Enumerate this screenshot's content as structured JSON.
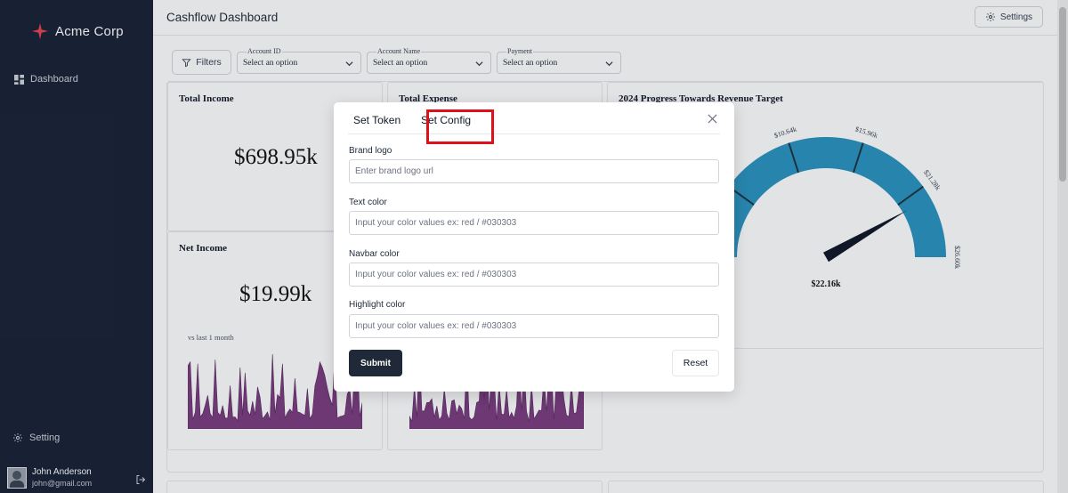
{
  "sidebar": {
    "brand_name": "Acme Corp",
    "brand_color": "#e8454f",
    "nav_items": [
      {
        "label": "Dashboard",
        "icon": "dashboard-icon"
      },
      {
        "label": "Setting",
        "icon": "gear-icon"
      }
    ],
    "user": {
      "name": "John Anderson",
      "email": "john@gmail.com"
    }
  },
  "header": {
    "title": "Cashflow Dashboard",
    "settings_label": "Settings"
  },
  "filters": {
    "button_label": "Filters",
    "selects": [
      {
        "label": "Account ID",
        "value": "Select an option"
      },
      {
        "label": "Account Name",
        "value": "Select an option"
      },
      {
        "label": "Payment",
        "value": "Select an option"
      }
    ]
  },
  "cards": {
    "total_income": {
      "title": "Total Income",
      "value": "$698.95k"
    },
    "total_expense": {
      "title": "Total Expense"
    },
    "net_income": {
      "title": "Net Income",
      "value": "$19.99k",
      "comparison": "vs last 1 month"
    },
    "gauge": {
      "title": "2024 Progress Towards Revenue Target",
      "ticks": [
        "$10.64k",
        "$15.96k",
        "$21.28k",
        "$26.60k"
      ],
      "value_label": "$22.16k",
      "value": 22.16,
      "max": 26.6,
      "color": "#2b93c0"
    }
  },
  "sparkline_color": "#7a3d7f",
  "modal": {
    "tabs": [
      {
        "label": "Set Token",
        "active": false
      },
      {
        "label": "Set Config",
        "active": true
      }
    ],
    "fields": [
      {
        "label": "Brand logo",
        "placeholder": "Enter brand logo url"
      },
      {
        "label": "Text color",
        "placeholder": "Input your color values ex: red / #030303"
      },
      {
        "label": "Navbar color",
        "placeholder": "Input your color values ex: red / #030303"
      },
      {
        "label": "Highlight color",
        "placeholder": "Input your color values ex: red / #030303"
      }
    ],
    "submit_label": "Submit",
    "reset_label": "Reset",
    "highlight_color": "#e0101a"
  }
}
